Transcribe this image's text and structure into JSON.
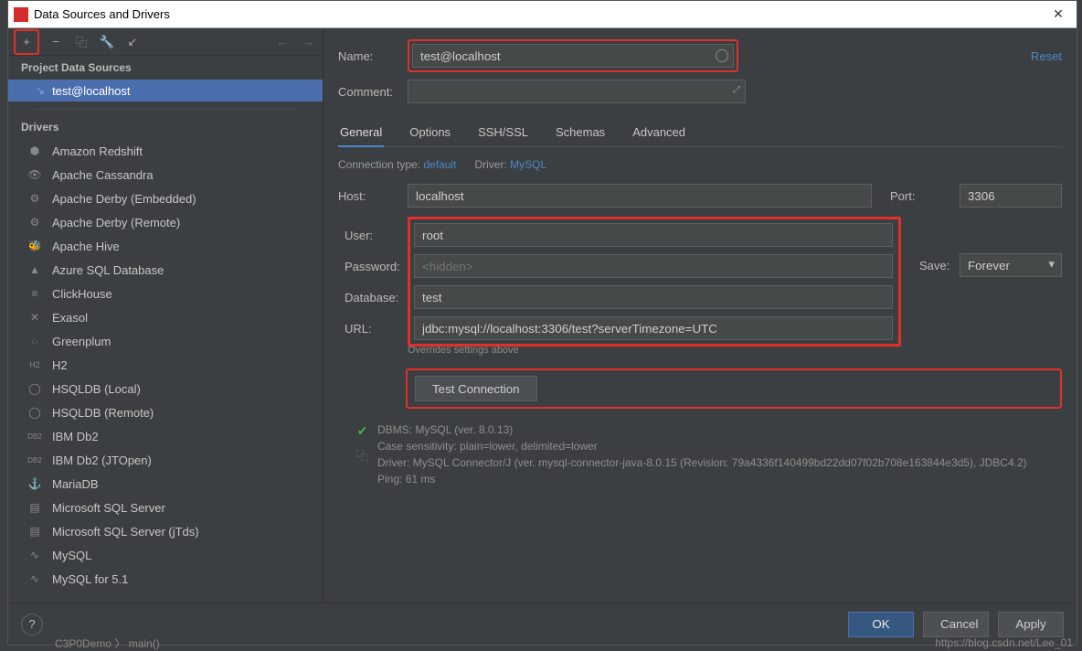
{
  "window": {
    "title": "Data Sources and Drivers"
  },
  "toolbar": {
    "add": "+",
    "remove": "−",
    "copy": "⿻",
    "settings": "🔧",
    "revert": "↙",
    "back": "←",
    "forward": "→"
  },
  "sidebar": {
    "project_header": "Project Data Sources",
    "datasources": [
      {
        "label": "test@localhost"
      }
    ],
    "drivers_header": "Drivers",
    "drivers": [
      {
        "label": "Amazon Redshift",
        "icon": "⬢"
      },
      {
        "label": "Apache Cassandra",
        "icon": "👁"
      },
      {
        "label": "Apache Derby (Embedded)",
        "icon": "⚙"
      },
      {
        "label": "Apache Derby (Remote)",
        "icon": "⚙"
      },
      {
        "label": "Apache Hive",
        "icon": "🐝"
      },
      {
        "label": "Azure SQL Database",
        "icon": "▲"
      },
      {
        "label": "ClickHouse",
        "icon": "≡"
      },
      {
        "label": "Exasol",
        "icon": "✕"
      },
      {
        "label": "Greenplum",
        "icon": "◌"
      },
      {
        "label": "H2",
        "icon": "H2"
      },
      {
        "label": "HSQLDB (Local)",
        "icon": "◯"
      },
      {
        "label": "HSQLDB (Remote)",
        "icon": "◯"
      },
      {
        "label": "IBM Db2",
        "icon": "DB2"
      },
      {
        "label": "IBM Db2 (JTOpen)",
        "icon": "DB2"
      },
      {
        "label": "MariaDB",
        "icon": "⚓"
      },
      {
        "label": "Microsoft SQL Server",
        "icon": "▤"
      },
      {
        "label": "Microsoft SQL Server (jTds)",
        "icon": "▤"
      },
      {
        "label": "MySQL",
        "icon": "∿"
      },
      {
        "label": "MySQL for 5.1",
        "icon": "∿"
      }
    ]
  },
  "form": {
    "name_label": "Name:",
    "name_value": "test@localhost",
    "reset": "Reset",
    "comment_label": "Comment:",
    "comment_value": "",
    "tabs": [
      "General",
      "Options",
      "SSH/SSL",
      "Schemas",
      "Advanced"
    ],
    "conn_type_label": "Connection type:",
    "conn_type_value": "default",
    "driver_label": "Driver:",
    "driver_value": "MySQL",
    "host_label": "Host:",
    "host_value": "localhost",
    "port_label": "Port:",
    "port_value": "3306",
    "user_label": "User:",
    "user_value": "root",
    "password_label": "Password:",
    "password_placeholder": "<hidden>",
    "save_label": "Save:",
    "save_value": "Forever",
    "database_label": "Database:",
    "database_value": "test",
    "url_label": "URL:",
    "url_value": "jdbc:mysql://localhost:3306/test?serverTimezone=UTC",
    "overrides_hint": "Overrides settings above",
    "test_button": "Test Connection"
  },
  "status": {
    "line1": "DBMS: MySQL (ver. 8.0.13)",
    "line2": "Case sensitivity: plain=lower, delimited=lower",
    "line3": "Driver: MySQL Connector/J (ver. mysql-connector-java-8.0.15 (Revision: 79a4336f140499bd22dd07f02b708e163844e3d5), JDBC4.2)",
    "line4": "Ping: 61 ms"
  },
  "footer": {
    "ok": "OK",
    "cancel": "Cancel",
    "apply": "Apply"
  },
  "watermark": "https://blog.csdn.net/Lee_01",
  "breadcrumb": "C3P0Demo 〉 main()"
}
